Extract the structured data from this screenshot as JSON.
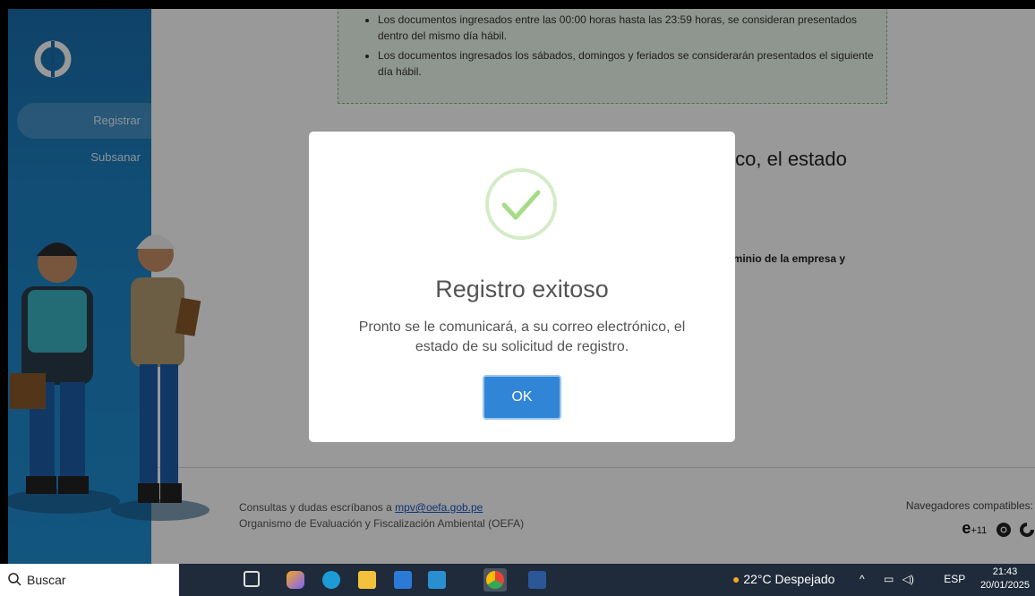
{
  "sidebar": {
    "items": [
      {
        "label": "Registrar"
      },
      {
        "label": "Subsanar"
      }
    ]
  },
  "notice": {
    "items": [
      "Los documentos ingresados entre las 00:00 horas hasta las 23:59 horas, se consideran presentados dentro del mismo día hábil.",
      "Los documentos ingresados los sábados, domingos y feriados se considerarán presentados el siguiente día hábil."
    ]
  },
  "background": {
    "heading_fragment": "nico, el estado",
    "text_fragment": "dominio de la empresa y"
  },
  "footer": {
    "contact_prefix": "Consultas y dudas escríbanos a ",
    "contact_email": "mpv@oefa.gob.pe",
    "organization": "Organismo de Evaluación y Fiscalización Ambiental (OEFA)",
    "browsers_title": "Navegadores compatibles:",
    "browsers_version": "+11",
    "browser_icons": [
      "ie-icon",
      "chrome-icon",
      "firefox-icon"
    ]
  },
  "modal": {
    "icon": "check-icon",
    "title": "Registro exitoso",
    "text": "Pronto se le comunicará, a su correo electrónico, el estado de su solicitud de registro.",
    "ok_label": "OK"
  },
  "taskbar": {
    "search_placeholder": "Buscar",
    "weather": "22°C  Despejado",
    "language": "ESP",
    "time": "21:43",
    "date": "20/01/2025"
  },
  "colors": {
    "sidebar": "#1e8fd3",
    "ok_button": "#3085d6",
    "success": "#a5dc86",
    "taskbar": "#1f2b3a"
  }
}
